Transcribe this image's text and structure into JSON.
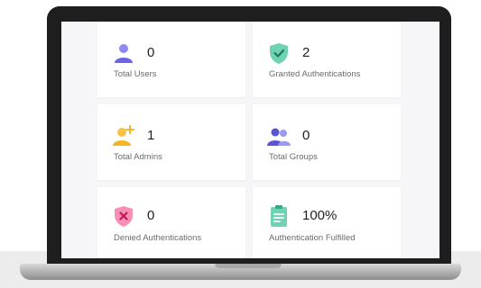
{
  "stats": {
    "total_users": {
      "value": "0",
      "label": "Total Users",
      "icon": "user-icon",
      "color": "#7b73f0"
    },
    "granted_authentications": {
      "value": "2",
      "label": "Granted Authentications",
      "icon": "shield-check-icon",
      "color": "#4dc2a0"
    },
    "total_admins": {
      "value": "1",
      "label": "Total Admins",
      "icon": "add-user-icon",
      "color": "#f5b623"
    },
    "total_groups": {
      "value": "0",
      "label": "Total Groups",
      "icon": "group-icon",
      "color": "#5b55d6"
    },
    "denied_authentications": {
      "value": "0",
      "label": "Denied Authentications",
      "icon": "shield-x-icon",
      "color": "#f35c8f"
    },
    "authentication_fulfilled": {
      "value": "100%",
      "label": "Authentication Fulfilled",
      "icon": "clipboard-icon",
      "color": "#4dc2a0"
    }
  }
}
